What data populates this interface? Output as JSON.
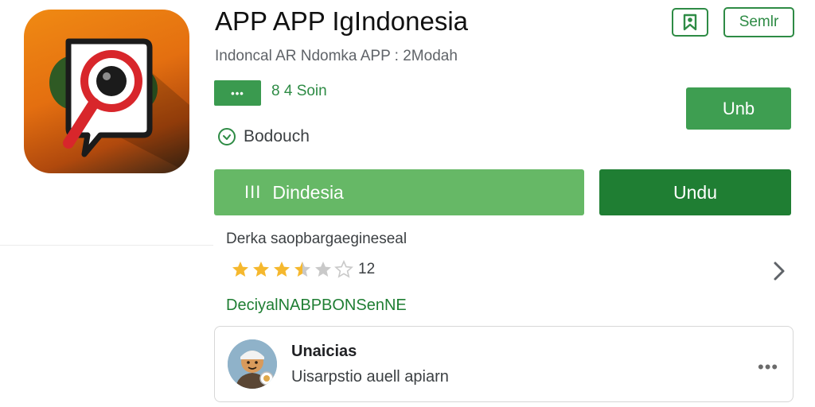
{
  "app": {
    "title": "APP APP IgIndonesia",
    "subtitle": "Indoncal AR Ndomka APP : 2Modah"
  },
  "header_actions": {
    "icon_button_icon": "bookmark-icon",
    "outline_button_label": "Semlr"
  },
  "meta": {
    "chip_label": "•••",
    "chip_text": "8 4 Soin",
    "install_small_label": "Unb",
    "clock_label": "Bodouch"
  },
  "actions": {
    "wide_button_icon": "ІІІ",
    "wide_button_label": "Dindesia",
    "primary_button_label": "Undu"
  },
  "ratings": {
    "heading": "Derka saopbargaegineseal",
    "stars_filled": 3.5,
    "stars_total": 6,
    "count": "12"
  },
  "link": {
    "text": "DeciyalNABPBONSenNE"
  },
  "review_card": {
    "title": "Unaicias",
    "subtitle": "Uisarpstio auell apiarn",
    "more_icon": "more-horizontal-icon"
  },
  "colors": {
    "accent": "#2e8b45",
    "primary": "#1f7e33",
    "light_green": "#66b866",
    "star": "#f5b82e",
    "star_empty": "#c9c9c9"
  }
}
